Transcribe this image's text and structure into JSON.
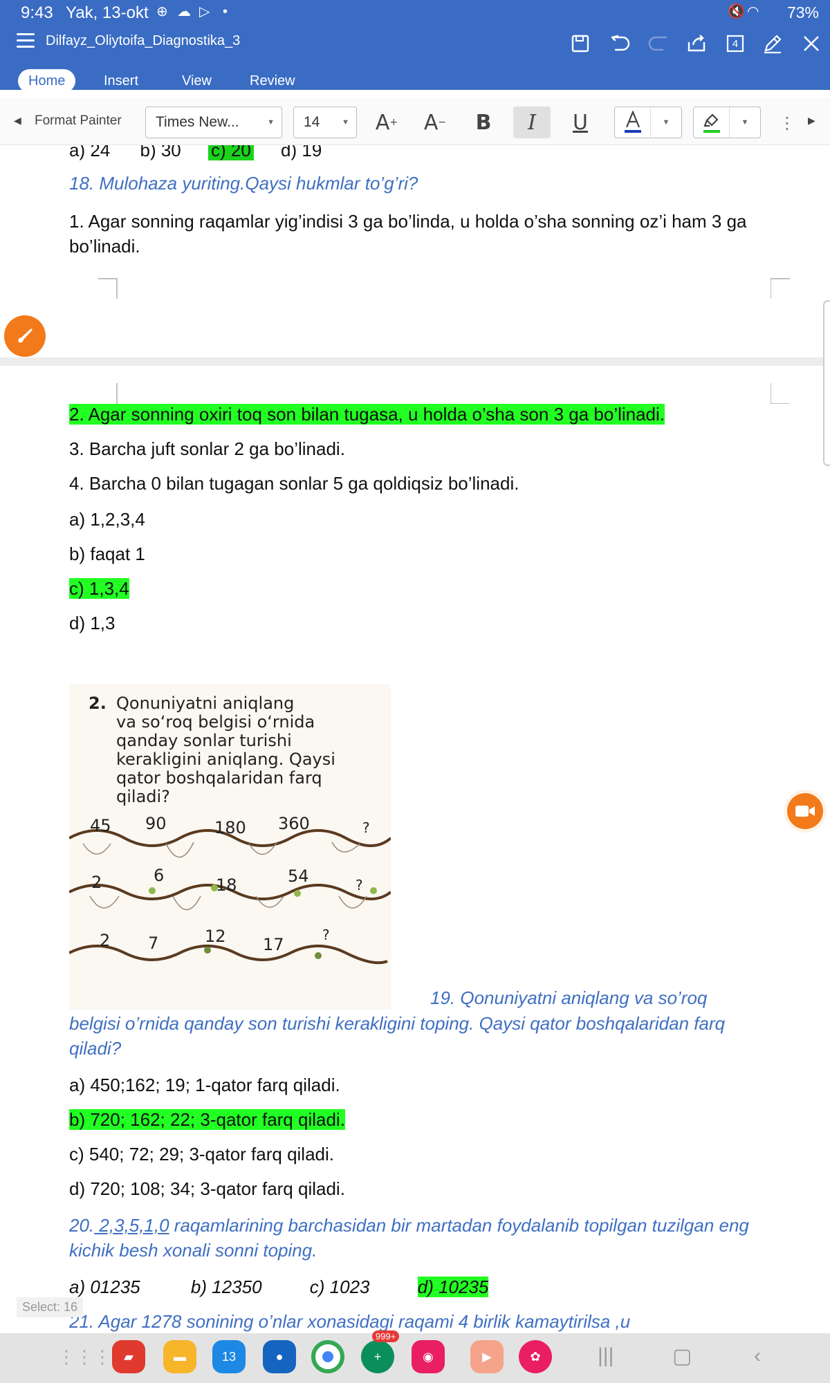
{
  "status_bar": {
    "time": "9:43",
    "date": "Yak, 13-okt",
    "battery": "73%"
  },
  "title_bar": {
    "doc_title": "Dilfayz_Oliytoifa_Diagnostika_3",
    "page_count_badge": "4",
    "tabs": [
      "Home",
      "Insert",
      "View",
      "Review"
    ],
    "active_tab": "Home"
  },
  "toolbar": {
    "format_painter": "Format Painter",
    "font_name": "Times New...",
    "font_size": "14",
    "icons": [
      "grow-font-icon",
      "shrink-font-icon",
      "bold-icon",
      "italic-icon",
      "underline-icon",
      "font-color-icon",
      "highlight-icon",
      "more-icon"
    ],
    "font_color": "#1a3bb5",
    "highlight_color": "#22cc22"
  },
  "document": {
    "prev_options": {
      "a": "a) 24",
      "b": "b) 30",
      "c": "c) 20",
      "d": "d) 19"
    },
    "q18": {
      "title": "18. Mulohaza yuriting.Qaysi hukmlar to’g’ri?",
      "s1": "1. Agar sonning raqamlar yig’indisi 3 ga bo’linda, u holda o’sha sonning oz’i ham 3 ga bo’linadi.",
      "s2": "2. Agar sonning oxiri toq son bilan tugasa, u holda o’sha son 3 ga bo’linadi.",
      "s3": "3. Barcha juft sonlar 2 ga bo’linadi.",
      "s4": "4. Barcha 0 bilan tugagan sonlar 5 ga qoldiqsiz bo’linadi.",
      "a": "a) 1,2,3,4",
      "b": "b) faqat 1",
      "c": "c) 1,3,4",
      "d": "d) 1,3"
    },
    "textbook_image": {
      "task_number": "2.",
      "task_text": "Qonuniyatni aniqlang\nva so‘roq belgisi o‘rnida\nqanday sonlar turishi\nkerakligini aniqlang. Qaysi\nqator boshqalaridan farq\nqiladi?",
      "row1": [
        "45",
        "90",
        "180",
        "360",
        "?"
      ],
      "row2": [
        "2",
        "6",
        "18",
        "54",
        "?"
      ],
      "row3": [
        "2",
        "7",
        "12",
        "17",
        "?"
      ]
    },
    "q19": {
      "title_start": "19. Qonuniyatni aniqlang va so’roq",
      "title_rest": "belgisi o’rnida qanday son turishi kerakligini toping. Qaysi qator boshqalaridan farq qiladi?",
      "a": "a) 450;162; 19;  1-qator farq qiladi.",
      "b": "b) 720; 162; 22; 3-qator farq qiladi.",
      "c": "c) 540; 72; 29; 3-qator farq qiladi.",
      "d": "d) 720; 108; 34; 3-qator farq qiladi."
    },
    "q20": {
      "num": "20.",
      "digits": " 2,3,5,1,0",
      "title_rest": " raqamlarining barchasidan bir martadan foydalanib topilgan tuzilgan eng kichik besh xonali sonni toping.",
      "a": "a) 01235",
      "b": "b) 12350",
      "c": "c) 1023",
      "d": "d) 10235"
    },
    "q21_partial": "21. Agar 1278 sonining o’nlar xonasidagi raqami 4 birlik kamaytirilsa ,u"
  },
  "select_chip": "Select: 16",
  "taskbar": {
    "calendar_day": "13",
    "badge": "999+"
  },
  "colors": {
    "brand": "#3a6cc4",
    "highlight": "#22ff22",
    "question_text": "#3f6fc2",
    "fab": "#f27a1a"
  }
}
